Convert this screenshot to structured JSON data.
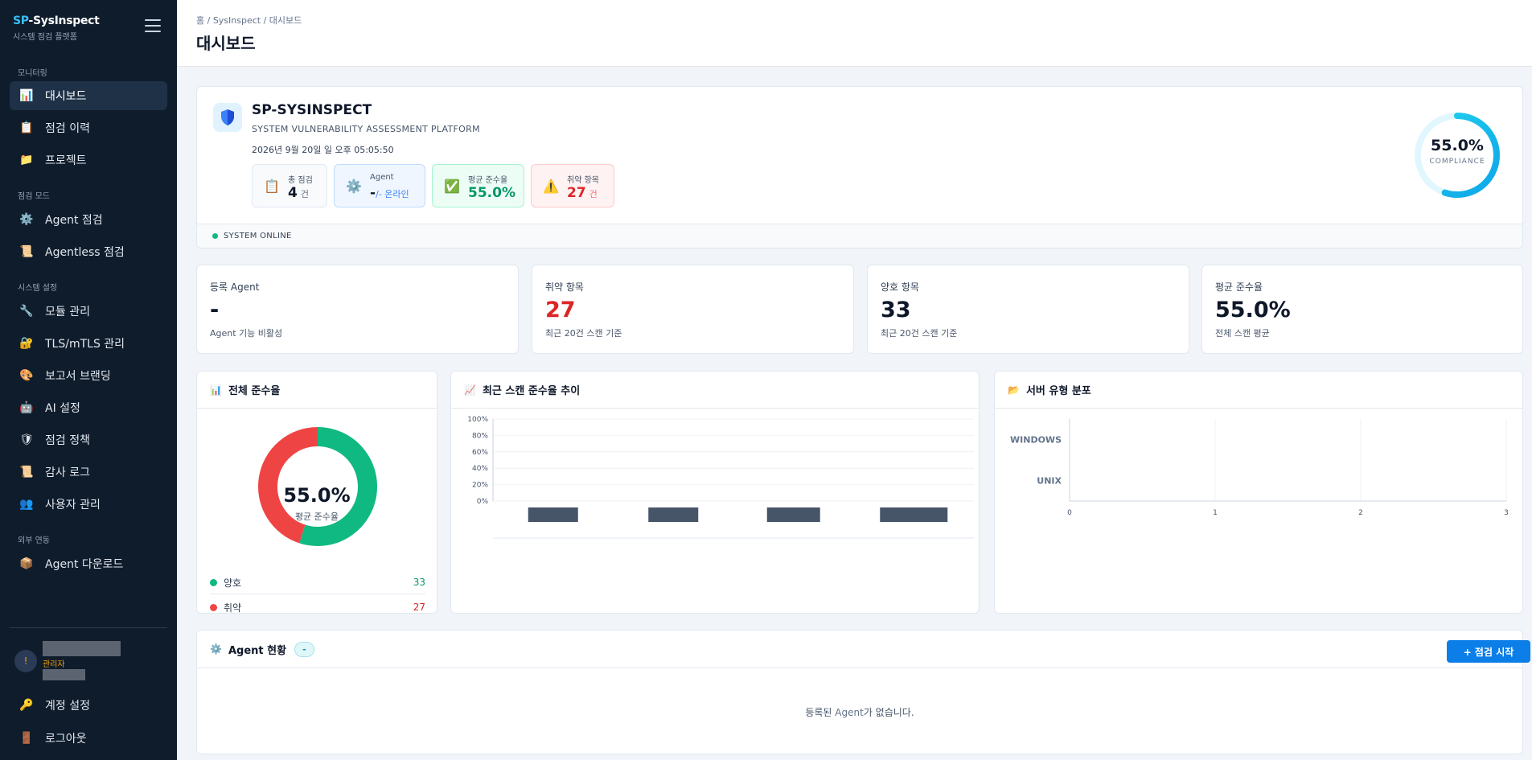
{
  "sidebar": {
    "brand_prefix": "SP",
    "brand_suffix": "-SysInspect",
    "brand_sub": "시스템 점검 플랫폼",
    "sections": [
      "모니터링",
      "점검 모드",
      "시스템 설정",
      "외부 연동"
    ],
    "items": [
      {
        "label": "대시보드",
        "icon": "chart-icon"
      },
      {
        "label": "점검 이력",
        "icon": "clipboard-icon"
      },
      {
        "label": "프로젝트",
        "icon": "folder-icon"
      },
      {
        "label": "Agent 점검",
        "icon": "gear-icon"
      },
      {
        "label": "Agentless 점검",
        "icon": "scroll-icon"
      },
      {
        "label": "모듈 관리",
        "icon": "wrench-icon"
      },
      {
        "label": "TLS/mTLS 관리",
        "icon": "lock-icon"
      },
      {
        "label": "보고서 브랜딩",
        "icon": "palette-icon"
      },
      {
        "label": "AI 설정",
        "icon": "robot-icon"
      },
      {
        "label": "점검 정책",
        "icon": "shield-icon"
      },
      {
        "label": "감사 로그",
        "icon": "scroll-icon"
      },
      {
        "label": "사용자 관리",
        "icon": "users-icon"
      },
      {
        "label": "Agent 다운로드",
        "icon": "package-icon"
      }
    ],
    "user": {
      "role": "관리자"
    },
    "footer": [
      {
        "label": "계정 설정",
        "icon": "key-icon"
      },
      {
        "label": "로그아웃",
        "icon": "door-icon"
      }
    ]
  },
  "header": {
    "breadcrumb": "홈 / SysInspect / 대시보드",
    "title": "대시보드"
  },
  "hero": {
    "title": "SP-SYSINSPECT",
    "subtitle": "SYSTEM VULNERABILITY ASSESSMENT PLATFORM",
    "datetime": "2026년 9월 20일 일 오후 05:05:50",
    "stats": [
      {
        "label": "총 점검",
        "value": "4",
        "unit": "건"
      },
      {
        "label": "Agent",
        "value": "-",
        "unit": "/- 온라인"
      },
      {
        "label": "평균 준수율",
        "value": "55.0%",
        "unit": ""
      },
      {
        "label": "취약 항목",
        "value": "27",
        "unit": "건"
      }
    ],
    "status": "SYSTEM ONLINE",
    "gauge": {
      "value_text": "55.0%",
      "label": "COMPLIANCE",
      "fraction": 0.55
    }
  },
  "metrics": [
    {
      "label": "등록 Agent",
      "value": "-",
      "foot": "Agent 기능 비활성"
    },
    {
      "label": "취약 항목",
      "value": "27",
      "foot": "최근 20건 스캔 기준"
    },
    {
      "label": "양호 항목",
      "value": "33",
      "foot": "최근 20건 스캔 기준"
    },
    {
      "label": "평균 준수율",
      "value": "55.0%",
      "foot": "전체 스캔 평균"
    }
  ],
  "compliance_card": {
    "title": "전체 준수율",
    "center_value": "55.0%",
    "center_label": "평균 준수율",
    "legend": [
      {
        "label": "양호",
        "value": "33",
        "color": "#10b981"
      },
      {
        "label": "취약",
        "value": "27",
        "color": "#ef4444"
      }
    ]
  },
  "trend_card": {
    "title": "최근 스캔 준수율 추이"
  },
  "server_card": {
    "title": "서버 유형 분포"
  },
  "chart_data": [
    {
      "type": "pie",
      "title": "전체 준수율",
      "labels": [
        "양호",
        "취약"
      ],
      "values": [
        33,
        27
      ],
      "colors": [
        "#10b981",
        "#ef4444"
      ]
    },
    {
      "type": "bar",
      "title": "최근 스캔 준수율 추이",
      "categories": [
        "",
        "",
        "",
        ""
      ],
      "values": [
        0,
        0,
        0,
        0
      ],
      "ylim": [
        0,
        100
      ],
      "yticks": [
        "0%",
        "20%",
        "40%",
        "60%",
        "80%",
        "100%"
      ],
      "grid": true
    },
    {
      "type": "bar",
      "orientation": "horizontal",
      "title": "서버 유형 분포",
      "categories": [
        "WINDOWS",
        "UNIX"
      ],
      "values": [
        0,
        0
      ],
      "xlim": [
        0,
        3
      ],
      "xticks": [
        "0",
        "1",
        "2",
        "3"
      ]
    }
  ],
  "agents": {
    "title": "Agent 현황",
    "badge": "-",
    "button": "+ 점검 시작",
    "empty_prefix": "등록된 ",
    "empty_agent": "Agent",
    "empty_suffix": "가 없습니다."
  },
  "colors": {
    "sidebar_bg": "#0f1c2b",
    "accent": "#0b7ee8",
    "good": "#10b981",
    "bad": "#ef4444",
    "gauge_start": "#0ea5e9",
    "gauge_end": "#22d3ee"
  }
}
